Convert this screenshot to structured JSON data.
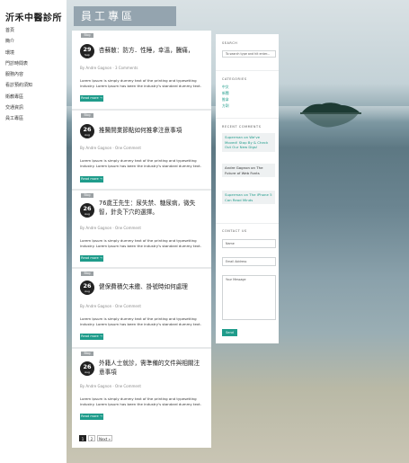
{
  "site": {
    "logo": "沂禾中醫診所",
    "nav": [
      "首頁",
      "簡介",
      "環境",
      "門診時間表",
      "服務內容",
      "看診預約須知",
      "衛教專區",
      "交通資訊",
      "員工專區"
    ]
  },
  "page": {
    "title": "員工專區"
  },
  "colors": {
    "accent": "#1f9c8b",
    "badge": "#222222",
    "title_bg": "#889aa6"
  },
  "posts": [
    {
      "category": "Blog",
      "day": "29",
      "month": "Sep",
      "title": "杏蘇散：防方．性睡，幸溫，騰痛，",
      "author": "Andre Gagnon",
      "comments": "3 Comments",
      "excerpt": "Lorem Ipsum is simply dummy text of the printing and typesetting industry. Lorem Ipsum has been the industry's standard dummy text.",
      "more": "Read more →"
    },
    {
      "category": "Blog",
      "day": "26",
      "month": "Aug",
      "title": "推醫開業節點如何推拿注意事項",
      "author": "Andre Gagnon",
      "comments": "One Comment",
      "excerpt": "Lorem Ipsum is simply dummy text of the printing and typesetting industry. Lorem Ipsum has been the industry's standard dummy text.",
      "more": "Read more →"
    },
    {
      "category": "Blog",
      "day": "26",
      "month": "Aug",
      "title": "76歲王先生：尿失禁、糖尿病，微失智，針灸下穴的選擇。",
      "author": "Andre Gagnon",
      "comments": "One Comment",
      "excerpt": "Lorem Ipsum is simply dummy text of the printing and typesetting industry. Lorem Ipsum has been the industry's standard dummy text.",
      "more": "Read more →"
    },
    {
      "category": "Blog",
      "day": "26",
      "month": "Aug",
      "title": "健保費積欠未繳、掛號時如何處理",
      "author": "Andre Gagnon",
      "comments": "One Comment",
      "excerpt": "Lorem Ipsum is simply dummy text of the printing and typesetting industry. Lorem Ipsum has been the industry's standard dummy text.",
      "more": "Read more →"
    },
    {
      "category": "Blog",
      "day": "26",
      "month": "Aug",
      "title": "外籍人士就診，需準備的文件與相關注意事項",
      "author": "Andre Gagnon",
      "comments": "One Comment",
      "excerpt": "Lorem Ipsum is simply dummy text of the printing and typesetting industry. Lorem Ipsum has been the industry's standard dummy text.",
      "more": "Read more →"
    }
  ],
  "pagination": {
    "pages": [
      "1",
      "2"
    ],
    "next": "Next »",
    "current": "1"
  },
  "sidebar": {
    "search": {
      "title": "SEARCH",
      "placeholder": "To search type and hit enter..."
    },
    "categories": {
      "title": "CATEGORIES",
      "items": [
        "中文",
        "新聞",
        "推拿",
        "方劑"
      ]
    },
    "recent_comments": {
      "title": "RECENT COMMENTS",
      "items": [
        {
          "text": "Superman on We've Moved! Stop By & Check Out Our New Digs!"
        },
        {
          "text": "Andre Gagnon on The Future of Web Fonts"
        },
        {
          "text": "Superman on The iPhone 5 Can Read Minds"
        }
      ]
    },
    "contact": {
      "title": "CONTACT US",
      "name": "Name",
      "email": "Email Address",
      "message": "Your Message",
      "send": "Send"
    }
  }
}
